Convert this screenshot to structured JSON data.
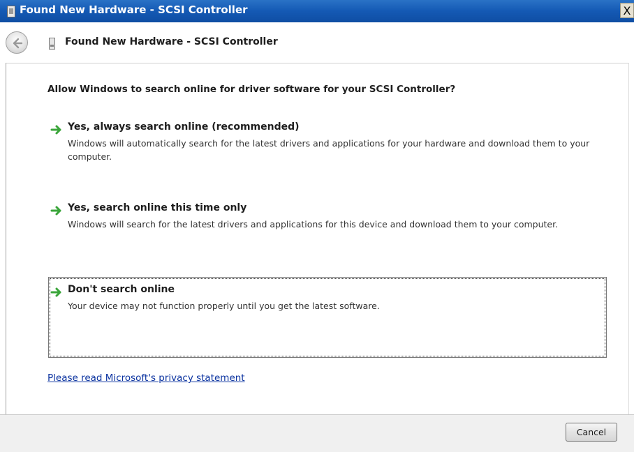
{
  "window": {
    "title": "Found New Hardware - SCSI Controller",
    "close_label": "X"
  },
  "navbar": {
    "title": "Found New Hardware - SCSI Controller",
    "back_icon": "back-arrow-icon",
    "device_icon": "hardware-device-icon"
  },
  "main": {
    "question": "Allow Windows to search online for driver software for your SCSI Controller?",
    "options": [
      {
        "icon": "green-arrow-icon",
        "heading": "Yes, always search online (recommended)",
        "description": "Windows will automatically search for the latest drivers and applications for your hardware and download them to your computer."
      },
      {
        "icon": "green-arrow-icon",
        "heading": "Yes, search online this time only",
        "description": "Windows will search for the latest drivers and applications for this device and download them to your computer."
      },
      {
        "icon": "green-arrow-icon",
        "heading": "Don't search online",
        "description": "Your device may not function properly until you get the latest software.",
        "selected": true
      }
    ],
    "privacy_link": "Please read Microsoft's  privacy statement"
  },
  "footer": {
    "cancel_label": "Cancel"
  },
  "colors": {
    "titlebar": "#1459b4",
    "link": "#0b33a0",
    "arrow": "#3aa53a"
  }
}
